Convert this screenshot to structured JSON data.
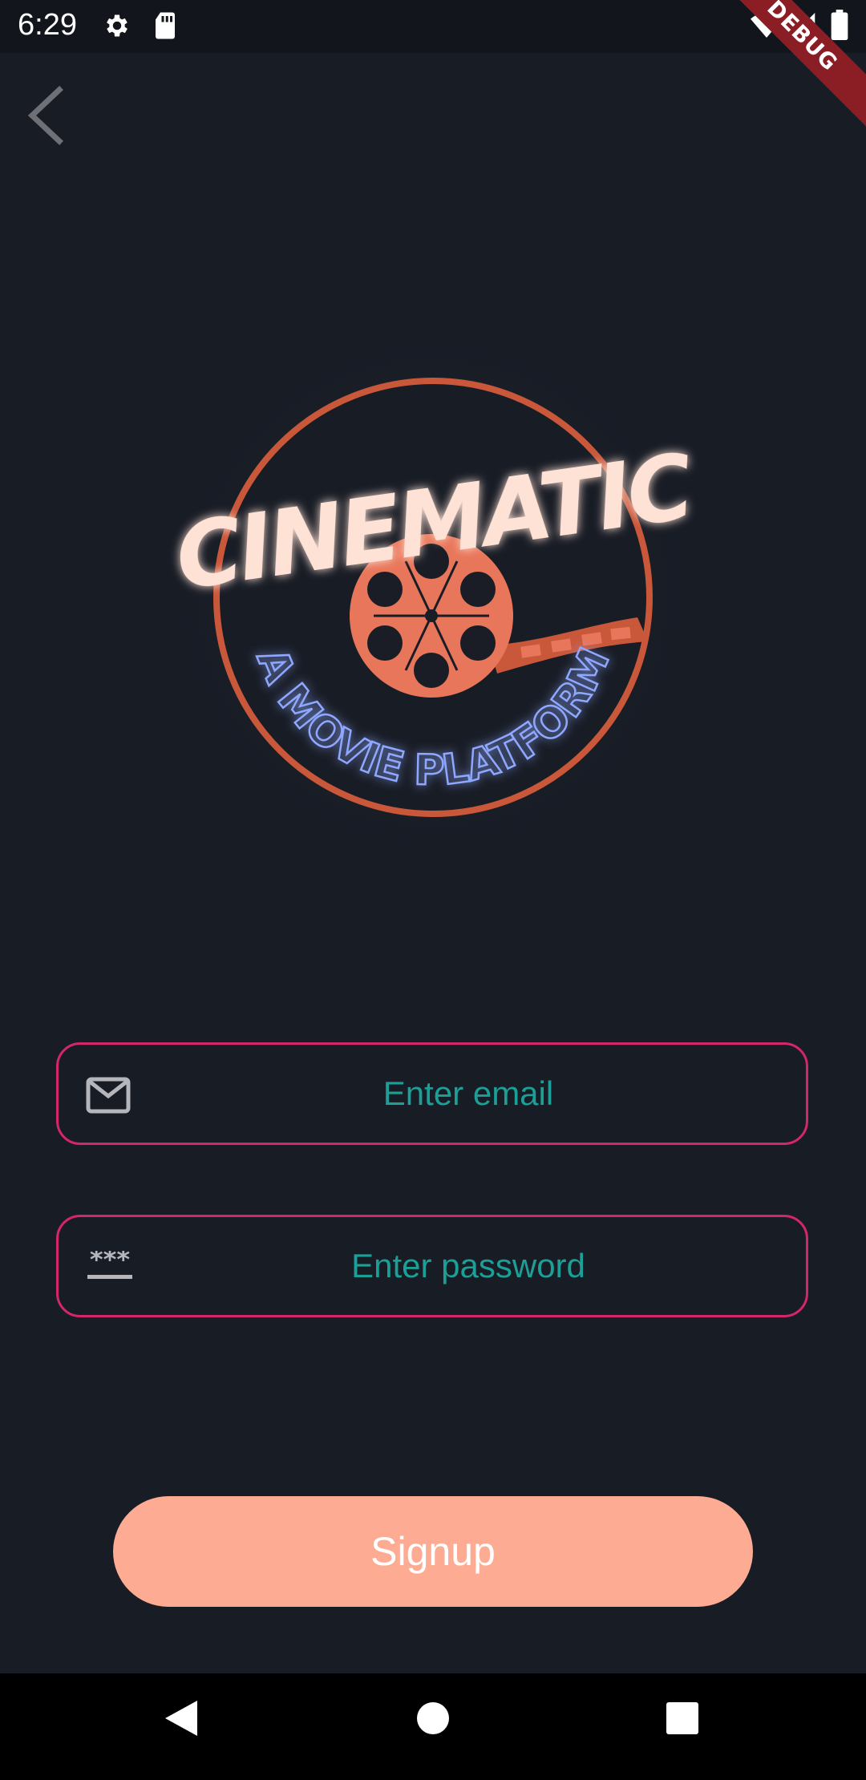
{
  "status_bar": {
    "time": "6:29",
    "icons": [
      "settings-icon",
      "sd-card-icon",
      "wifi-icon",
      "cell-signal-icon",
      "battery-icon"
    ],
    "debug_label": "DEBUG"
  },
  "header": {
    "back_icon": "chevron-left-icon"
  },
  "logo": {
    "title": "CINEMATIC",
    "tagline": "A MOVIE PLATFORM",
    "colors": {
      "ring": "#c9573a",
      "title": "#ffe2d6",
      "reel": "#e8765a",
      "tagline": "#8fa8ff"
    }
  },
  "form": {
    "email": {
      "placeholder": "Enter email",
      "icon": "mail-icon"
    },
    "password": {
      "placeholder": "Enter password",
      "icon": "password-icon"
    },
    "signup_label": "Signup"
  },
  "colors": {
    "background": "#181c25",
    "input_border": "#d4266a",
    "placeholder": "#1b9f96",
    "button": "#fdab92"
  },
  "nav_bar": {
    "buttons": [
      "back-triangle-icon",
      "home-circle-icon",
      "recents-square-icon"
    ]
  }
}
